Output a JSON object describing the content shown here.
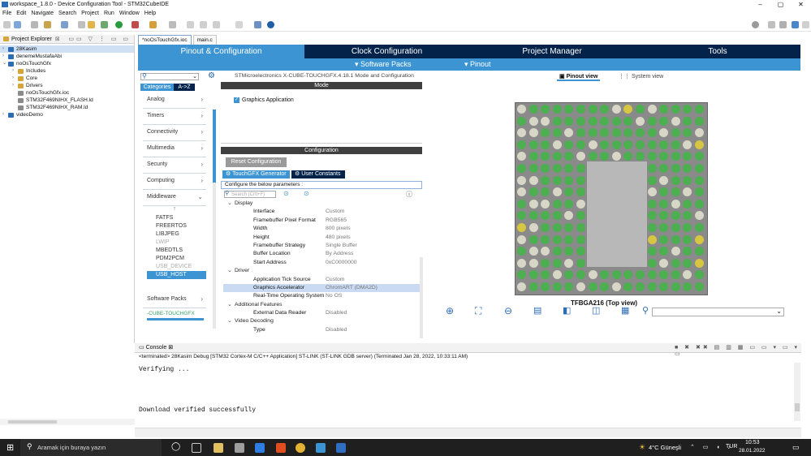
{
  "window": {
    "title": "workspace_1.8.0 - Device Configuration Tool - STM32CubeIDE",
    "min": "–",
    "max": "▢",
    "close": "✕"
  },
  "menu": [
    "File",
    "Edit",
    "Navigate",
    "Search",
    "Project",
    "Run",
    "Window",
    "Help"
  ],
  "project_explorer": {
    "title": "Project Explorer",
    "items": [
      {
        "label": "28Kasim",
        "level": 0,
        "icon": "project",
        "selected": true
      },
      {
        "label": "denemeMustafaAbi",
        "level": 0,
        "icon": "project"
      },
      {
        "label": "noOsTouchGfx",
        "level": 0,
        "icon": "project",
        "expanded": true
      },
      {
        "label": "Includes",
        "level": 1,
        "icon": "folder"
      },
      {
        "label": "Core",
        "level": 1,
        "icon": "folder"
      },
      {
        "label": "Drivers",
        "level": 1,
        "icon": "folder"
      },
      {
        "label": "noOsTouchGfx.ioc",
        "level": 1,
        "icon": "file"
      },
      {
        "label": "STM32F469NIHX_FLASH.ld",
        "level": 1,
        "icon": "file"
      },
      {
        "label": "STM32F469NIHX_RAM.ld",
        "level": 1,
        "icon": "file"
      },
      {
        "label": "videoDemo",
        "level": 0,
        "icon": "project"
      }
    ]
  },
  "editor_tabs": [
    {
      "label": "*noOsTouchGfx.ioc",
      "active": true
    },
    {
      "label": "main.c",
      "active": false
    }
  ],
  "main_tabs": [
    "Pinout & Configuration",
    "Clock Configuration",
    "Project Manager",
    "Tools"
  ],
  "sub_tabs": {
    "software_packs": "Software Packs",
    "pinout": "Pinout"
  },
  "categories": {
    "tab1": "Categories",
    "tab2": "A->Z",
    "items": [
      "Analog",
      "Timers",
      "Connectivity",
      "Multimedia",
      "Security",
      "Computing",
      "Middleware"
    ],
    "middleware": [
      "FATFS",
      "FREERTOS",
      "LIBJPEG",
      "LWIP",
      "MBEDTLS",
      "PDM2PCM",
      "USB_DEVICE",
      "USB_HOST"
    ],
    "software_packs_label": "Software Packs",
    "pack_item": "-CUBE-TOUCHGFX"
  },
  "mode": {
    "header": "STMicroelectronics X-CUBE-TOUCHGFX.4.18.1 Mode and Configuration",
    "section": "Mode",
    "checkbox": "Graphics Application"
  },
  "configuration": {
    "header": "Configuration",
    "reset": "Reset Configuration",
    "tab_a": "TouchGFX Generator",
    "tab_b": "User Constants",
    "hint": "Configure the below parameters :",
    "search_placeholder": "Search (Crtl+F)",
    "rows": [
      {
        "k": "Display",
        "sec": true
      },
      {
        "k": "Interface",
        "v": "Custom"
      },
      {
        "k": "Framebuffer Pixel Format",
        "v": "RGB565"
      },
      {
        "k": "Width",
        "v": "800 pixels"
      },
      {
        "k": "Height",
        "v": "480 pixels"
      },
      {
        "k": "Framebuffer Strategy",
        "v": "Single Buffer"
      },
      {
        "k": "Buffer Location",
        "v": "By Address"
      },
      {
        "k": "Start Address",
        "v": "0xC0000000"
      },
      {
        "k": "Driver",
        "sec": true
      },
      {
        "k": "Application Tick Source",
        "v": "Custom"
      },
      {
        "k": "Graphics Accelerator",
        "v": "ChromART (DMA2D)",
        "hl": true
      },
      {
        "k": "Real-Time Operating System",
        "v": "No OS"
      },
      {
        "k": "Additional Features",
        "sec": true
      },
      {
        "k": "External Data Reader",
        "v": "Disabled"
      },
      {
        "k": "Video Decoding",
        "sec": true
      },
      {
        "k": "Type",
        "v": "Disabled"
      }
    ]
  },
  "pinout": {
    "tab_a": "Pinout view",
    "tab_b": "System view",
    "chip_label": "TFBGA216 (Top view)"
  },
  "console": {
    "title": "Console",
    "status": "<terminated> 28Kasim Debug [STM32 Cortex-M C/C++ Application] ST-LINK (ST-LINK GDB server) (Terminated Jan 28, 2022, 10:33:11 AM)",
    "line1": "Verifying ...",
    "line2": "Download verified successfully"
  },
  "taskbar": {
    "search": "Aramak için buraya yazın",
    "weather": "4°C Güneşli",
    "lang": "TUR",
    "time": "10:53",
    "date": "28.01.2022"
  },
  "colors": {
    "dark_navy": "#03234b",
    "blue": "#3c95d2",
    "pin_green": "#4caf50",
    "pin_light": "#d8d6c6",
    "pin_yellow": "#d6c641",
    "chip": "#8a8a8a"
  }
}
